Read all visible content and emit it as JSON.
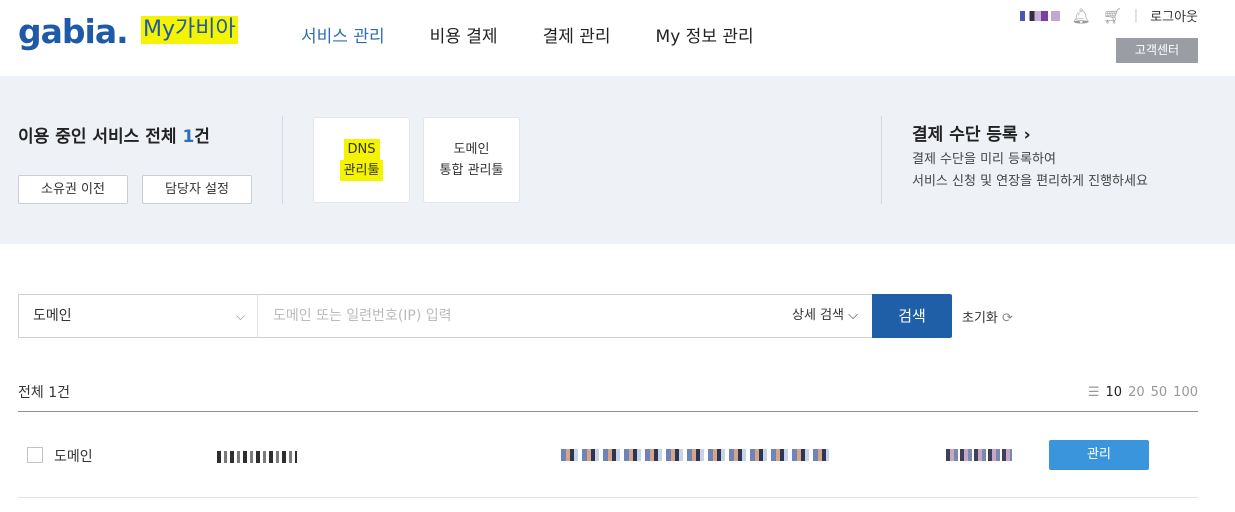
{
  "header": {
    "logo": "gabia.",
    "brand_sub": "My가비아",
    "nav": [
      "서비스 관리",
      "비용 결제",
      "결제 관리",
      "My 정보 관리"
    ],
    "active_nav": "서비스 관리",
    "logout": "로그아웃",
    "cs_button": "고객센터",
    "icons": [
      "bell-icon",
      "cart-icon"
    ]
  },
  "summary": {
    "title_prefix": "이용 중인 서비스 전체 ",
    "count": "1",
    "title_suffix": "건",
    "buttons": [
      "소유권 이전",
      "담당자 설정"
    ],
    "tiles": [
      {
        "line1": "DNS",
        "line2": "관리툴"
      },
      {
        "line1": "도메인",
        "line2": "통합 관리툴"
      }
    ],
    "payment": {
      "title": "결제 수단 등록",
      "desc_line1": "결제 수단을 미리 등록하여",
      "desc_line2": "서비스 신청 및 연장을 편리하게 진행하세요"
    }
  },
  "search": {
    "select_value": "도메인",
    "placeholder": "도메인 또는 일련번호(IP) 입력",
    "advanced": "상세 검색",
    "submit": "검색",
    "reset": "초기화"
  },
  "list": {
    "total": "전체 1건",
    "page_sizes": [
      "10",
      "20",
      "50",
      "100"
    ],
    "current_page_size": "10",
    "rows": [
      {
        "type": "도메인",
        "action": "관리"
      }
    ]
  },
  "colors": {
    "brand": "#1e5aa8",
    "accent": "#2e6eb5",
    "search_button": "#1f5fa8",
    "manage_button": "#3b95dd",
    "highlight": "#f5f400"
  }
}
